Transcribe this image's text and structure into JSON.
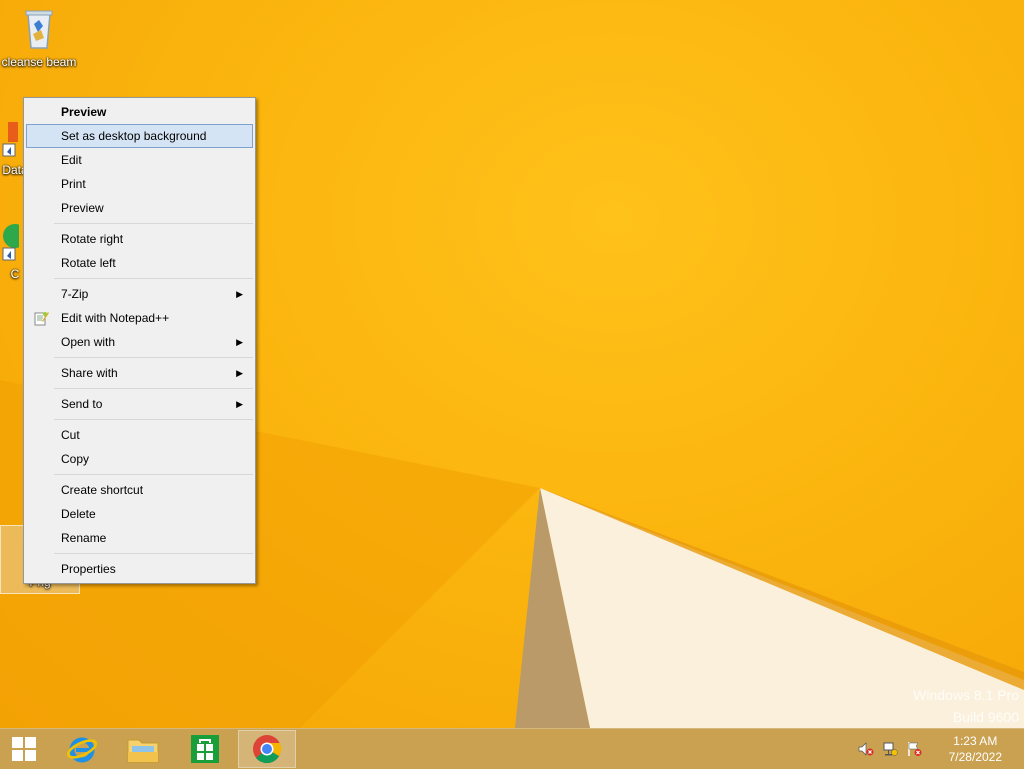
{
  "desktop_icons": [
    {
      "label": "cleanse beam"
    },
    {
      "label": "Data"
    },
    {
      "label": "C"
    },
    {
      "label": "Png"
    }
  ],
  "context_menu": {
    "items": [
      {
        "label": "Preview",
        "bold": true
      },
      {
        "label": "Set as desktop background",
        "highlight": true
      },
      {
        "label": "Edit"
      },
      {
        "label": "Print"
      },
      {
        "label": "Preview"
      },
      {
        "label": "Rotate right"
      },
      {
        "label": "Rotate left"
      },
      {
        "label": "7-Zip",
        "submenu": true
      },
      {
        "label": "Edit with Notepad++",
        "icon": "notepad-plus-plus-icon"
      },
      {
        "label": "Open with",
        "submenu": true
      },
      {
        "label": "Share with",
        "submenu": true
      },
      {
        "label": "Send to",
        "submenu": true
      },
      {
        "label": "Cut"
      },
      {
        "label": "Copy"
      },
      {
        "label": "Create shortcut"
      },
      {
        "label": "Delete"
      },
      {
        "label": "Rename"
      },
      {
        "label": "Properties"
      }
    ]
  },
  "watermark": {
    "line1": "Windows 8.1 Pro",
    "line2": "Build 9600"
  },
  "taskbar": {
    "apps": [
      "start-button",
      "internet-explorer-icon",
      "file-explorer-icon",
      "store-icon",
      "chrome-icon"
    ],
    "clock": {
      "time": "1:23 AM",
      "date": "7/28/2022"
    }
  },
  "colors": {
    "accent": "#f8b40c",
    "menu_highlight": "#d5e4f5"
  }
}
